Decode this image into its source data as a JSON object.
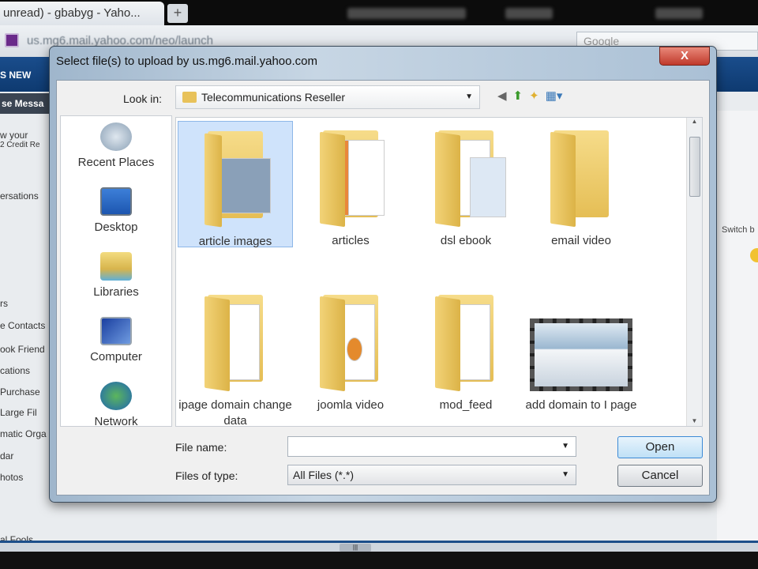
{
  "browser": {
    "tab_title": "unread) - gbabyg - Yaho...",
    "new_tab": "+",
    "url": "us.mg6.mail.yahoo.com/neo/launch",
    "search_placeholder": "Google"
  },
  "yahoo": {
    "new_button": "S NEW",
    "messages_tab": "se Messa",
    "left_nav": [
      "w your",
      "2 Credit Re",
      "ersations",
      "rs",
      "e Contacts",
      "ook Friend",
      "cations",
      "Purchase",
      "Large Fil",
      "matic Orga",
      "dar",
      "hotos",
      "al Fools"
    ],
    "switch_text": "Switch b",
    "scroll_grip": "|||"
  },
  "dialog": {
    "title": "Select file(s) to upload by us.mg6.mail.yahoo.com",
    "close": "X",
    "look_in_label": "Look in:",
    "look_in_value": "Telecommunications Reseller",
    "places": [
      {
        "label": "Recent Places",
        "icon": "recent-places-icon"
      },
      {
        "label": "Desktop",
        "icon": "desktop-icon"
      },
      {
        "label": "Libraries",
        "icon": "libraries-icon"
      },
      {
        "label": "Computer",
        "icon": "computer-icon"
      },
      {
        "label": "Network",
        "icon": "network-icon"
      }
    ],
    "files": [
      {
        "name": "article images",
        "selected": true
      },
      {
        "name": "articles"
      },
      {
        "name": "dsl ebook"
      },
      {
        "name": "email video"
      },
      {
        "name": "ipage domain change data"
      },
      {
        "name": "joomla video"
      },
      {
        "name": "mod_feed"
      },
      {
        "name": "add domain to I page"
      }
    ],
    "file_name_label": "File name:",
    "file_name_value": "",
    "files_of_type_label": "Files of type:",
    "files_of_type_value": "All Files (*.*)",
    "open": "Open",
    "cancel": "Cancel"
  }
}
